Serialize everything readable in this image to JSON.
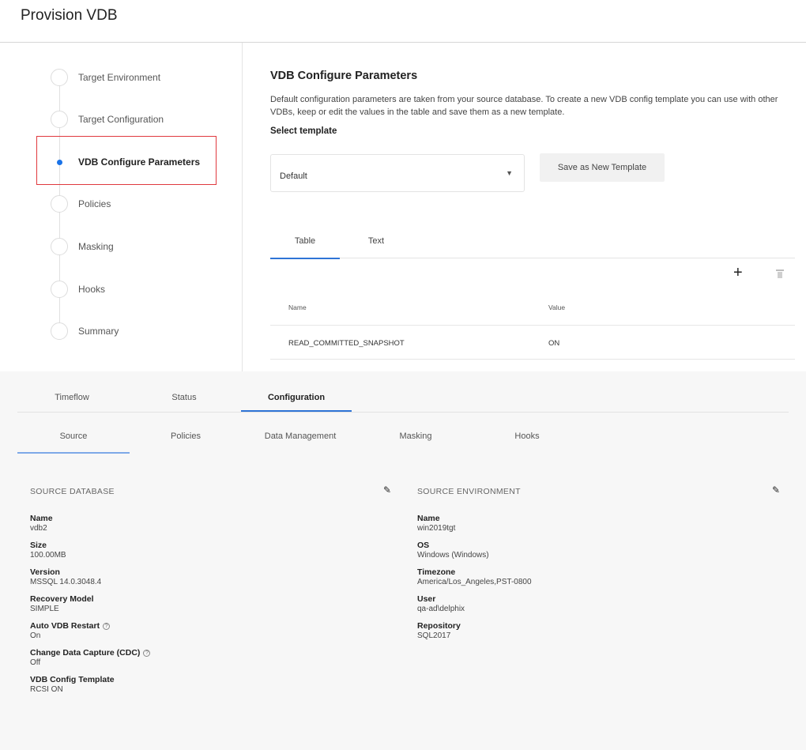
{
  "provision": {
    "title": "Provision VDB",
    "steps": [
      {
        "label": "Target Environment",
        "active": false
      },
      {
        "label": "Target Configuration",
        "active": false
      },
      {
        "label": "VDB Configure Parameters",
        "active": true
      },
      {
        "label": "Policies",
        "active": false
      },
      {
        "label": "Masking",
        "active": false
      },
      {
        "label": "Hooks",
        "active": false
      },
      {
        "label": "Summary",
        "active": false
      }
    ],
    "content": {
      "title": "VDB Configure Parameters",
      "description": "Default configuration parameters are taken from your source database. To create a new VDB config template you can use with other VDBs, keep or edit the values in the table and save them as a new template.",
      "select_label": "Select template",
      "template_value": "Default",
      "save_button": "Save as New Template",
      "tabs": [
        "Table",
        "Text"
      ],
      "active_tab": "Table",
      "table": {
        "headers": [
          "Name",
          "Value"
        ],
        "rows": [
          {
            "name": "READ_COMMITTED_SNAPSHOT",
            "value": "ON"
          }
        ]
      }
    }
  },
  "vdb": {
    "main_tabs": [
      "Timeflow",
      "Status",
      "Configuration"
    ],
    "active_main_tab": "Configuration",
    "sub_tabs": [
      "Source",
      "Policies",
      "Data Management",
      "Masking",
      "Hooks"
    ],
    "active_sub_tab": "Source",
    "source_database": {
      "header": "SOURCE DATABASE",
      "fields": [
        {
          "label": "Name",
          "value": "vdb2"
        },
        {
          "label": "Size",
          "value": "100.00MB"
        },
        {
          "label": "Version",
          "value": "MSSQL 14.0.3048.4"
        },
        {
          "label": "Recovery Model",
          "value": "SIMPLE"
        },
        {
          "label": "Auto VDB Restart",
          "value": "On"
        },
        {
          "label": "Change Data Capture (CDC)",
          "value": "Off"
        },
        {
          "label": "VDB Config Template",
          "value": "RCSI ON"
        }
      ]
    },
    "source_environment": {
      "header": "SOURCE ENVIRONMENT",
      "fields": [
        {
          "label": "Name",
          "value": "win2019tgt"
        },
        {
          "label": "OS",
          "value": "Windows (Windows)"
        },
        {
          "label": "Timezone",
          "value": "America/Los_Angeles,PST-0800"
        },
        {
          "label": "User",
          "value": "qa-ad\\delphix"
        },
        {
          "label": "Repository",
          "value": "SQL2017"
        }
      ]
    }
  },
  "colors": {
    "accent": "#2f74d6",
    "highlight_border": "#e0393e",
    "active_dot": "#1a73e8"
  },
  "icons": [
    "chevron-down-icon",
    "plus-icon",
    "trash-icon",
    "pencil-icon",
    "help-icon"
  ]
}
